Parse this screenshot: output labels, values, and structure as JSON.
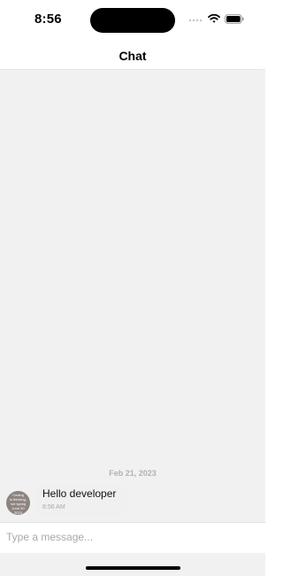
{
  "status_bar": {
    "time": "8:56",
    "icons": [
      "signal-icon",
      "wifi-icon",
      "battery-icon"
    ]
  },
  "header": {
    "title": "Chat"
  },
  "conversation": {
    "date_divider": "Feb 21, 2023",
    "messages": [
      {
        "text": "Hello developer",
        "time": "8:56 AM",
        "avatar_text": "Coding\nis thinking,\nnot typing\nJune 30\n2023"
      }
    ]
  },
  "composer": {
    "placeholder": "Type a message..."
  },
  "colors": {
    "background": "#f1f1f1",
    "header": "#ffffff",
    "date_text": "#b2b2b2",
    "placeholder": "#a9a9a9"
  }
}
